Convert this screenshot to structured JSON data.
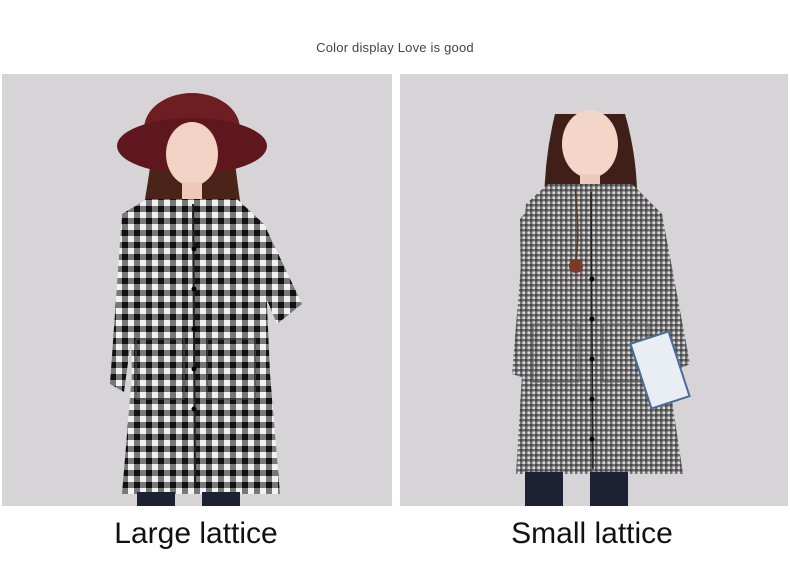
{
  "header": {
    "text": "Color display Love is good"
  },
  "photos": [
    {
      "name": "large-lattice-photo",
      "caption": "Large lattice",
      "pattern": "large-check",
      "colors": {
        "hat": "#6e1d22",
        "check": "#141414",
        "background": "#d6d4d7"
      }
    },
    {
      "name": "small-lattice-photo",
      "caption": "Small lattice",
      "pattern": "small-check",
      "colors": {
        "check": "#2c2c2c",
        "background": "#d6d4d7"
      }
    }
  ]
}
